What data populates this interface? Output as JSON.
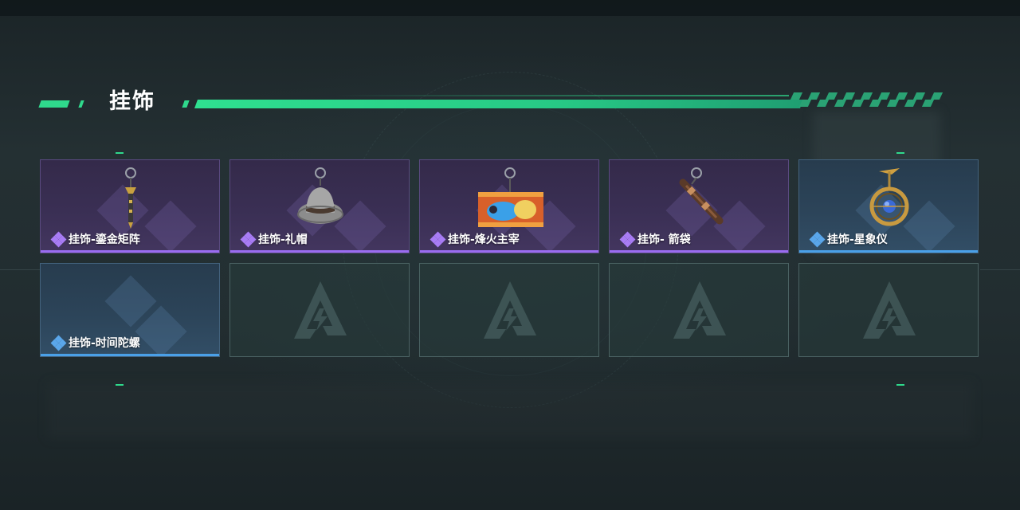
{
  "section": {
    "title": "挂饰"
  },
  "items": [
    {
      "name": "挂饰-鎏金矩阵",
      "rarity": "purple",
      "icon": "gilded-matrix-pendant-icon"
    },
    {
      "name": "挂饰-礼帽",
      "rarity": "purple",
      "icon": "top-hat-pendant-icon"
    },
    {
      "name": "挂饰-烽火主宰",
      "rarity": "purple",
      "icon": "beacon-ruler-pendant-icon"
    },
    {
      "name": "挂饰- 箭袋",
      "rarity": "purple",
      "icon": "quiver-pendant-icon"
    },
    {
      "name": "挂饰-星象仪",
      "rarity": "blue",
      "icon": "astrolabe-pendant-icon"
    },
    {
      "name": "挂饰-时间陀螺",
      "rarity": "blue",
      "icon": "time-top-pendant-icon"
    }
  ],
  "empty_slots": 4,
  "colors": {
    "accent_green": "#2fd98c",
    "rarity_purple": "#9a6cf0",
    "rarity_blue": "#4aa0e8"
  }
}
